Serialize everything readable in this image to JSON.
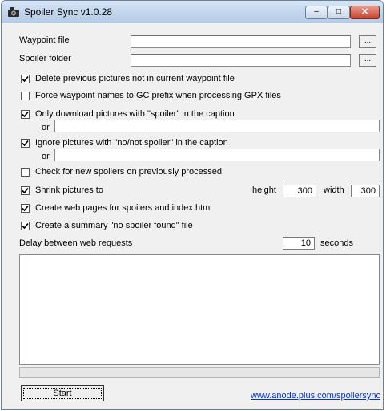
{
  "window": {
    "title": "Spoiler Sync v1.0.28"
  },
  "controls": {
    "minimize": "–",
    "maximize": "□",
    "close": "✕"
  },
  "fields": {
    "waypoint_label": "Waypoint file",
    "waypoint_value": "",
    "spoiler_label": "Spoiler folder",
    "spoiler_value": "",
    "browse_label": "..."
  },
  "options": {
    "delete_previous": {
      "label": "Delete previous pictures not in current waypoint file",
      "checked": true
    },
    "force_gc": {
      "label": "Force waypoint names to GC prefix when processing GPX files",
      "checked": false
    },
    "only_spoiler": {
      "label": "Only download pictures with \"spoiler\" in the caption",
      "checked": true
    },
    "only_spoiler_or_label": "or",
    "only_spoiler_or_value": "",
    "ignore_no_spoiler": {
      "label": "Ignore pictures with \"no/not spoiler\" in the caption",
      "checked": true
    },
    "ignore_or_label": "or",
    "ignore_or_value": "",
    "check_new": {
      "label": "Check for new spoilers on previously processed",
      "checked": false
    },
    "shrink": {
      "label": "Shrink pictures to",
      "checked": true
    },
    "height_label": "height",
    "height_value": "300",
    "width_label": "width",
    "width_value": "300",
    "web_pages": {
      "label": "Create web pages for spoilers and index.html",
      "checked": true
    },
    "summary": {
      "label": "Create a summary \"no spoiler found\" file",
      "checked": true
    }
  },
  "delay": {
    "label": "Delay between web requests",
    "value": "10",
    "unit": "seconds"
  },
  "log_text": "",
  "progress": 0,
  "start_label": "Start",
  "link_text": "www.anode.plus.com/spoilersync"
}
